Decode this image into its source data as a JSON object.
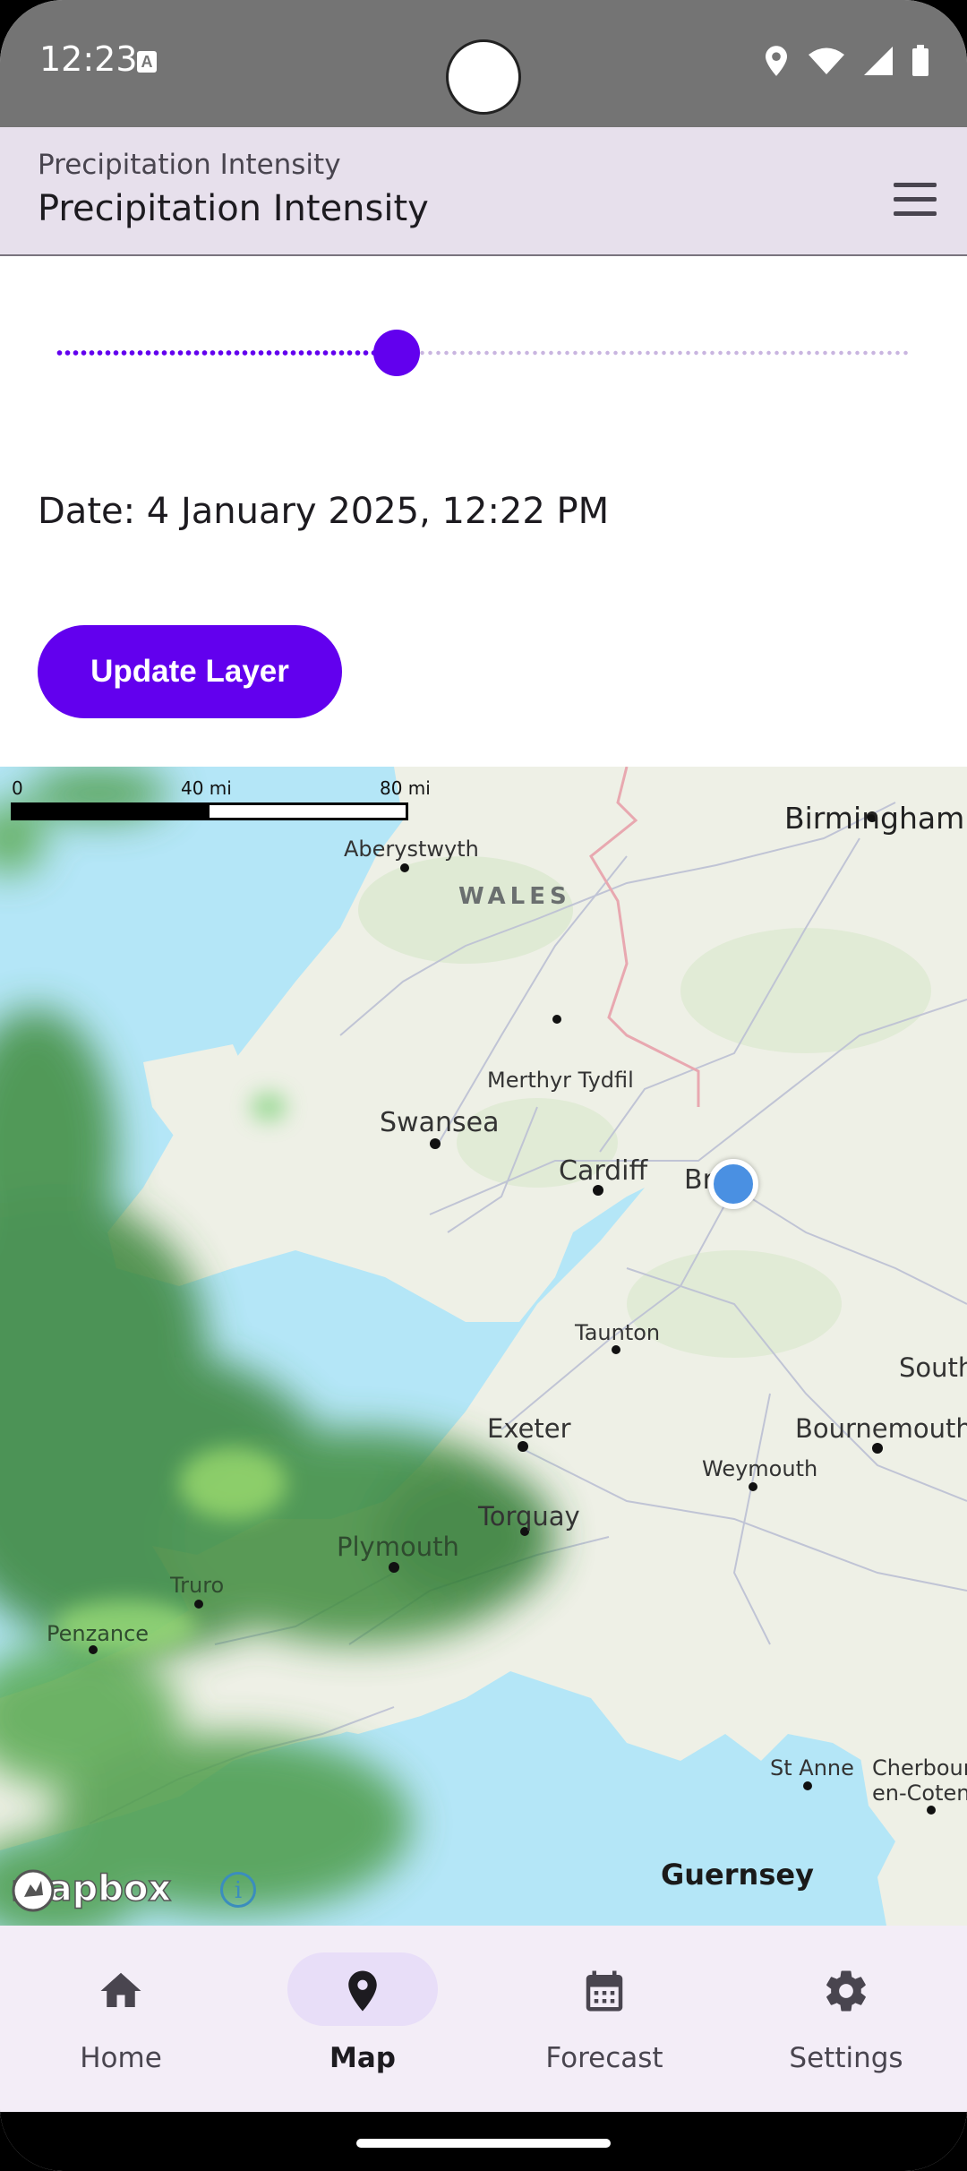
{
  "status_bar": {
    "time": "12:23",
    "notification_icon": "a-icon",
    "right_icons": [
      "location-icon",
      "wifi-icon",
      "signal-icon",
      "battery-icon"
    ]
  },
  "app_bar": {
    "subtitle": "Precipitation Intensity",
    "title": "Precipitation Intensity",
    "menu_icon": "menu-icon",
    "background": "#e7e0ec"
  },
  "slider": {
    "value": 0.4,
    "accent": "#6200ee"
  },
  "date_text": "Date: 4 January 2025, 12:22 PM",
  "update_button": {
    "label": "Update Layer",
    "color": "#6200ee"
  },
  "map": {
    "scale": {
      "zero": "0",
      "mid": "40 mi",
      "max": "80 mi"
    },
    "labels": {
      "birmingham": "Birmingham",
      "aberystwyth": "Aberystwyth",
      "wales": "WALES",
      "merthyr": "Merthyr Tydfil",
      "swansea": "Swansea",
      "cardiff": "Cardiff",
      "bristol": "Br    l",
      "taunton": "Taunton",
      "south": "South",
      "exeter": "Exeter",
      "bournemouth": "Bournemouth",
      "weymouth": "Weymouth",
      "torquay": "Torquay",
      "plymouth": "Plymouth",
      "truro": "Truro",
      "penzance": "Penzance",
      "st_anne": "St Anne",
      "cherbourg1": "Cherbour",
      "cherbourg2": "en-Coten",
      "guernsey": "Guernsey"
    },
    "attribution": "mapbox",
    "info_icon": "i"
  },
  "bottom_nav": {
    "items": [
      {
        "label": "Home",
        "icon": "home-icon",
        "active": false
      },
      {
        "label": "Map",
        "icon": "location-pin-icon",
        "active": true
      },
      {
        "label": "Forecast",
        "icon": "calendar-icon",
        "active": false
      },
      {
        "label": "Settings",
        "icon": "gear-icon",
        "active": false
      }
    ],
    "background": "#f3edf7"
  }
}
